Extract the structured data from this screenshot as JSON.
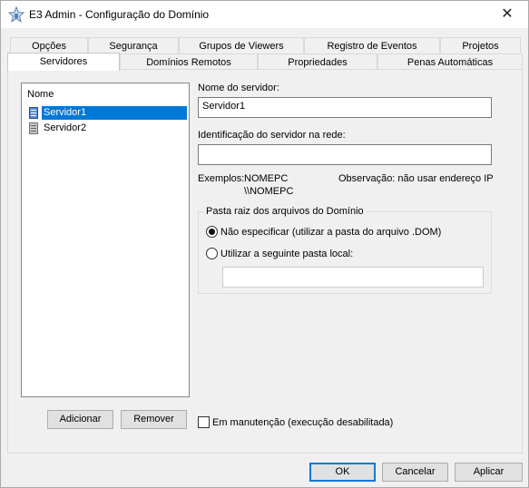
{
  "window": {
    "title": "E3 Admin - Configuração do Domínio",
    "close_symbol": "✕"
  },
  "tabs": {
    "row1": [
      "Opções",
      "Segurança",
      "Grupos de Viewers",
      "Registro de Eventos",
      "Projetos"
    ],
    "row2": [
      "Servidores",
      "Domínios Remotos",
      "Propriedades",
      "Penas Automáticas"
    ],
    "active": "Servidores"
  },
  "servers": {
    "header": "Nome",
    "items": [
      {
        "label": "Servidor1",
        "selected": true
      },
      {
        "label": "Servidor2",
        "selected": false
      }
    ],
    "add_label": "Adicionar",
    "remove_label": "Remover"
  },
  "form": {
    "server_name_label": "Nome do servidor:",
    "server_name_value": "Servidor1",
    "network_id_label": "Identificação do servidor na rede:",
    "network_id_value": "",
    "examples_label": "Exemplos:",
    "example1": "NOMEPC",
    "example2": "\\\\NOMEPC",
    "observation": "Observação: não usar endereço IP",
    "group_title": "Pasta raiz dos arquivos do Domínio",
    "radio1_label": "Não especificar (utilizar a pasta do arquivo .DOM)",
    "radio1_checked": true,
    "radio2_label": "Utilizar a seguinte pasta local:",
    "radio2_checked": false,
    "local_path_value": "",
    "maintenance_label": "Em manutenção (execução desabilitada)",
    "maintenance_checked": false
  },
  "dialog": {
    "ok": "OK",
    "cancel": "Cancelar",
    "apply": "Aplicar"
  },
  "colors": {
    "selection": "#0078d7",
    "default_button_border": "#0078d7"
  },
  "icons": {
    "app": "e3-admin-star-icon",
    "server": "server-icon"
  }
}
